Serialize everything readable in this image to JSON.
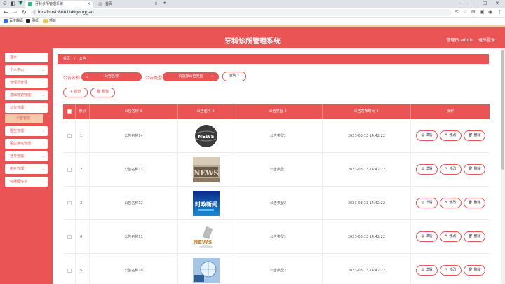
{
  "browser": {
    "tabs": [
      {
        "label": "牙科诊所管理系统",
        "active": true
      },
      {
        "label": "首页",
        "active": false
      }
    ],
    "new_tab": "+",
    "url": "localhost:8081/#/gonggao",
    "bookmarks": [
      "百度翻译",
      "图纸",
      "项目"
    ]
  },
  "header": {
    "title": "牙科诊所管理系统",
    "user": "管理员 admin",
    "logout": "退出登录"
  },
  "sidebar": {
    "items": [
      {
        "label": "首页",
        "has_chevron": false
      },
      {
        "label": "个人中心",
        "has_chevron": true
      },
      {
        "label": "管理员管理",
        "has_chevron": true
      },
      {
        "label": "基础数据管理",
        "has_chevron": true
      },
      {
        "label": "公告管理",
        "has_chevron": true,
        "expanded": true
      },
      {
        "label": "公告管理",
        "sub": true
      },
      {
        "label": "医生管理",
        "has_chevron": true
      },
      {
        "label": "医生排班管理",
        "has_chevron": true
      },
      {
        "label": "挂号管理",
        "has_chevron": true
      },
      {
        "label": "用户管理",
        "has_chevron": true
      },
      {
        "label": "轮播图信息",
        "has_chevron": true
      }
    ]
  },
  "breadcrumb": {
    "home": "首页",
    "sep": "/",
    "current": "公告"
  },
  "search": {
    "name_label": "公告名称",
    "name_placeholder": "公告名称",
    "type_label": "公告类型",
    "type_placeholder": "请选择公告类型",
    "search_button": "查询"
  },
  "actions": {
    "add": "新增",
    "delete": "删除"
  },
  "table": {
    "headers": [
      "索引",
      "公告名称",
      "公告图片",
      "公告类型",
      "公告发布时间",
      "操作"
    ],
    "rows": [
      {
        "index": "1",
        "name": "公告名称14",
        "type": "公告类型1",
        "time": "2023-03-13 14:42:22",
        "thumb": "news-globe"
      },
      {
        "index": "2",
        "name": "公告名称13",
        "type": "公告类型1",
        "time": "2023-03-13 14:42:22",
        "thumb": "news-paper"
      },
      {
        "index": "3",
        "name": "公告名称12",
        "type": "公告类型2",
        "time": "2023-03-13 14:42:22",
        "thumb": "news-blue",
        "thumb_text": "时政新闻"
      },
      {
        "index": "4",
        "name": "公告名称11",
        "type": "公告类型1",
        "time": "2023-03-13 14:42:22",
        "thumb": "news-3d"
      },
      {
        "index": "5",
        "name": "公告名称10",
        "type": "公告类型2",
        "time": "2023-03-13 14:42:22",
        "thumb": "news-digital"
      }
    ],
    "row_actions": [
      "详情",
      "修改",
      "删除"
    ]
  },
  "colors": {
    "accent": "#ea5455",
    "peach": "#f6c9a7"
  }
}
